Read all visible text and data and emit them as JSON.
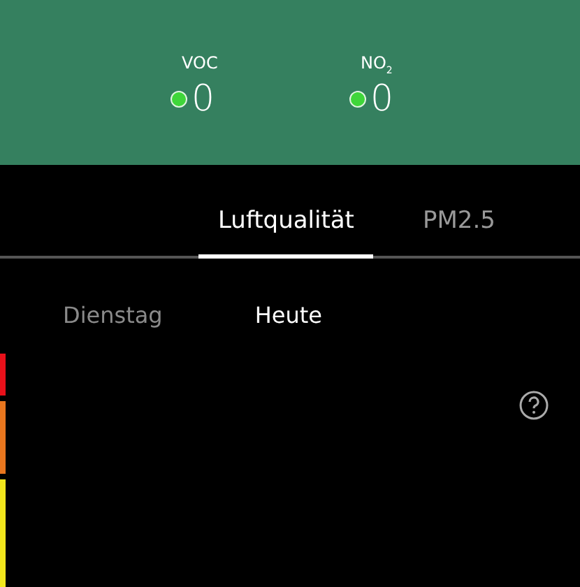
{
  "readings": [
    {
      "label": "VOC",
      "value": "0",
      "color": "#3fd63a"
    },
    {
      "label": "NO$_{2}$",
      "value": "0",
      "color": "#3fd63a"
    }
  ],
  "tabs": [
    {
      "label": "Luftqualität",
      "selected": true
    },
    {
      "label": "PM2.5",
      "selected": false
    }
  ],
  "days": [
    {
      "label": "Dienstag",
      "selected": false
    },
    {
      "label": "Heute",
      "selected": true
    }
  ],
  "scale": [
    {
      "color": "#e8101a"
    },
    {
      "color": "#e8761e"
    },
    {
      "color": "#f2e61c"
    }
  ]
}
